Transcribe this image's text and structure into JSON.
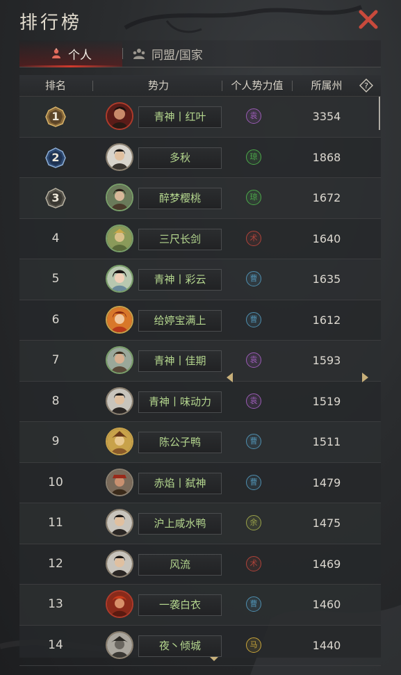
{
  "window": {
    "title": "排行榜"
  },
  "tabs": [
    {
      "label": "个人",
      "active": true
    },
    {
      "label": "同盟/国家",
      "active": false
    }
  ],
  "columns": {
    "rank": "排名",
    "faction": "势力",
    "power": "个人势力值",
    "region": "所属州"
  },
  "colors": {
    "accent_red": "#d13a2d",
    "name_green": "#b4d68e",
    "state_purple": "#9a5bb5",
    "state_green": "#4caa4a",
    "state_red": "#b0433a",
    "state_blue": "#4f8fb0",
    "state_olive": "#9aa24a",
    "state_gold": "#c9a53a"
  },
  "rows": [
    {
      "rank": "1",
      "name": "青神丨红叶",
      "state": "袁",
      "state_color": "#9a5bb5",
      "power": "3354"
    },
    {
      "rank": "2",
      "name": "多秋",
      "state": "琼",
      "state_color": "#4caa4a",
      "power": "1868"
    },
    {
      "rank": "3",
      "name": "醉梦樱桃",
      "state": "琼",
      "state_color": "#4caa4a",
      "power": "1672"
    },
    {
      "rank": "4",
      "name": "三尺长剑",
      "state": "术",
      "state_color": "#b0433a",
      "power": "1640"
    },
    {
      "rank": "5",
      "name": "青神丨彩云",
      "state": "曹",
      "state_color": "#4f8fb0",
      "power": "1635"
    },
    {
      "rank": "6",
      "name": "给婷宝满上",
      "state": "曹",
      "state_color": "#4f8fb0",
      "power": "1612"
    },
    {
      "rank": "7",
      "name": "青神丨佳期",
      "state": "袁",
      "state_color": "#9a5bb5",
      "power": "1593"
    },
    {
      "rank": "8",
      "name": "青神丨味动力",
      "state": "袁",
      "state_color": "#9a5bb5",
      "power": "1519"
    },
    {
      "rank": "9",
      "name": "陈公子鸭",
      "state": "曹",
      "state_color": "#4f8fb0",
      "power": "1511"
    },
    {
      "rank": "10",
      "name": "赤焰丨弑神",
      "state": "曹",
      "state_color": "#4f8fb0",
      "power": "1479"
    },
    {
      "rank": "11",
      "name": "沪上咸水鸭",
      "state": "余",
      "state_color": "#9aa24a",
      "power": "1475"
    },
    {
      "rank": "12",
      "name": "风流",
      "state": "术",
      "state_color": "#b0433a",
      "power": "1469"
    },
    {
      "rank": "13",
      "name": "一袭白衣",
      "state": "曹",
      "state_color": "#4f8fb0",
      "power": "1460"
    },
    {
      "rank": "14",
      "name": "夜丶倾城",
      "state": "马",
      "state_color": "#c9a53a",
      "power": "1440"
    }
  ]
}
